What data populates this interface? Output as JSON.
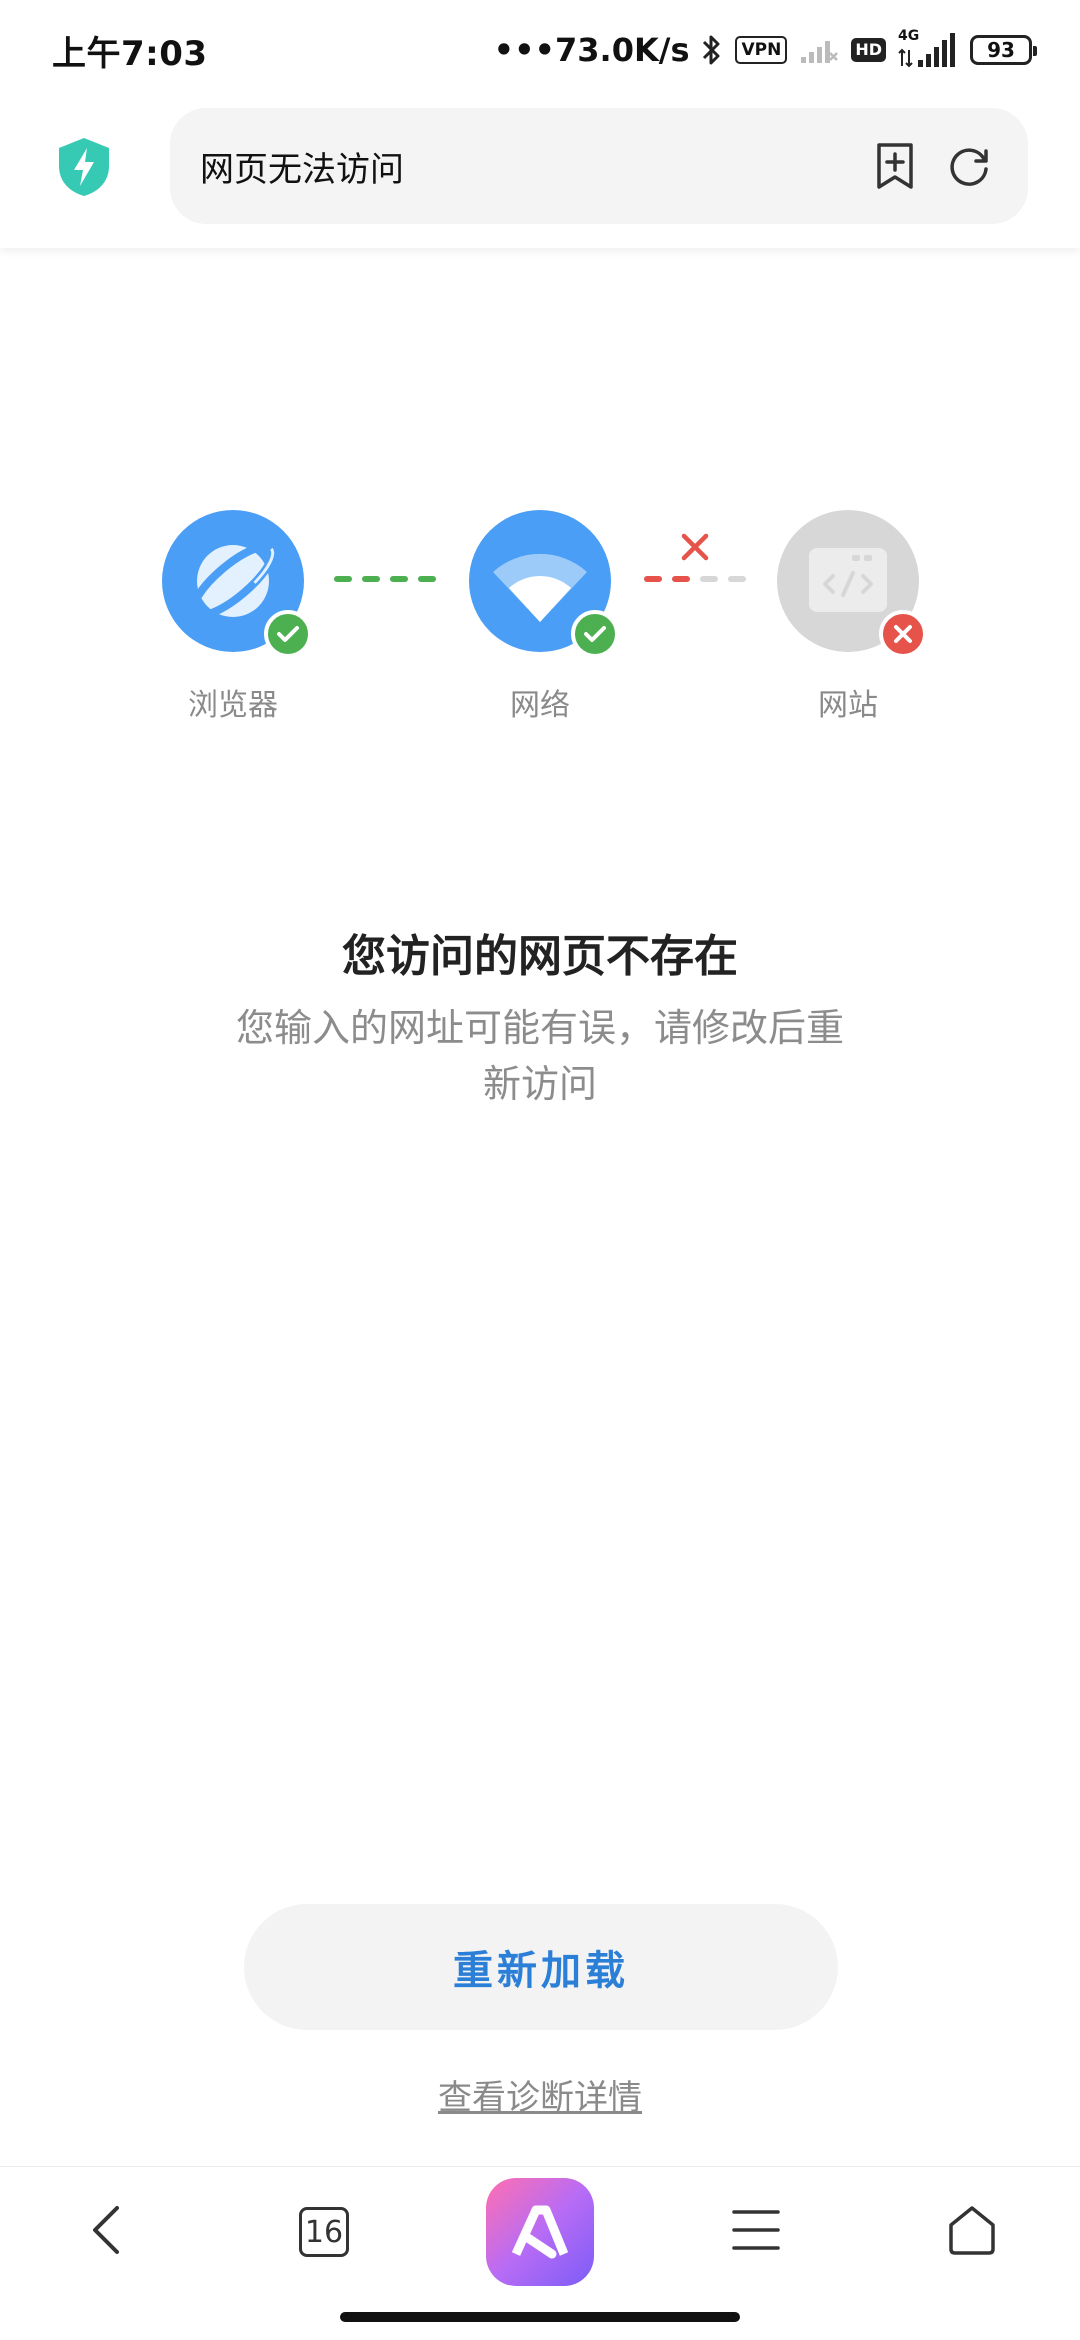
{
  "status_bar": {
    "time": "上午7:03",
    "speed": "•••73.0K/s",
    "vpn": "VPN",
    "hd": "HD",
    "network_type": "4G",
    "battery": "93"
  },
  "address_bar": {
    "title": "网页无法访问",
    "icons": [
      "shield-icon",
      "bookmark-add-icon",
      "refresh-icon"
    ]
  },
  "diagram": {
    "nodes": [
      {
        "label": "浏览器",
        "status": "ok"
      },
      {
        "label": "网络",
        "status": "ok"
      },
      {
        "label": "网站",
        "status": "error"
      }
    ],
    "colors": {
      "ok": "#4caf50",
      "error": "#e5534b",
      "node_blue": "#4a9ef5",
      "node_gray": "#d7d7d7"
    }
  },
  "message": {
    "title": "您访问的网页不存在",
    "subtitle": "您输入的网址可能有误，请修改后重新访问"
  },
  "actions": {
    "reload": "重新加载",
    "diagnose": "查看诊断详情"
  },
  "bottom_nav": {
    "tab_count": "16",
    "items": [
      "back-icon",
      "tabs-icon",
      "app-logo-icon",
      "menu-icon",
      "home-icon"
    ]
  }
}
